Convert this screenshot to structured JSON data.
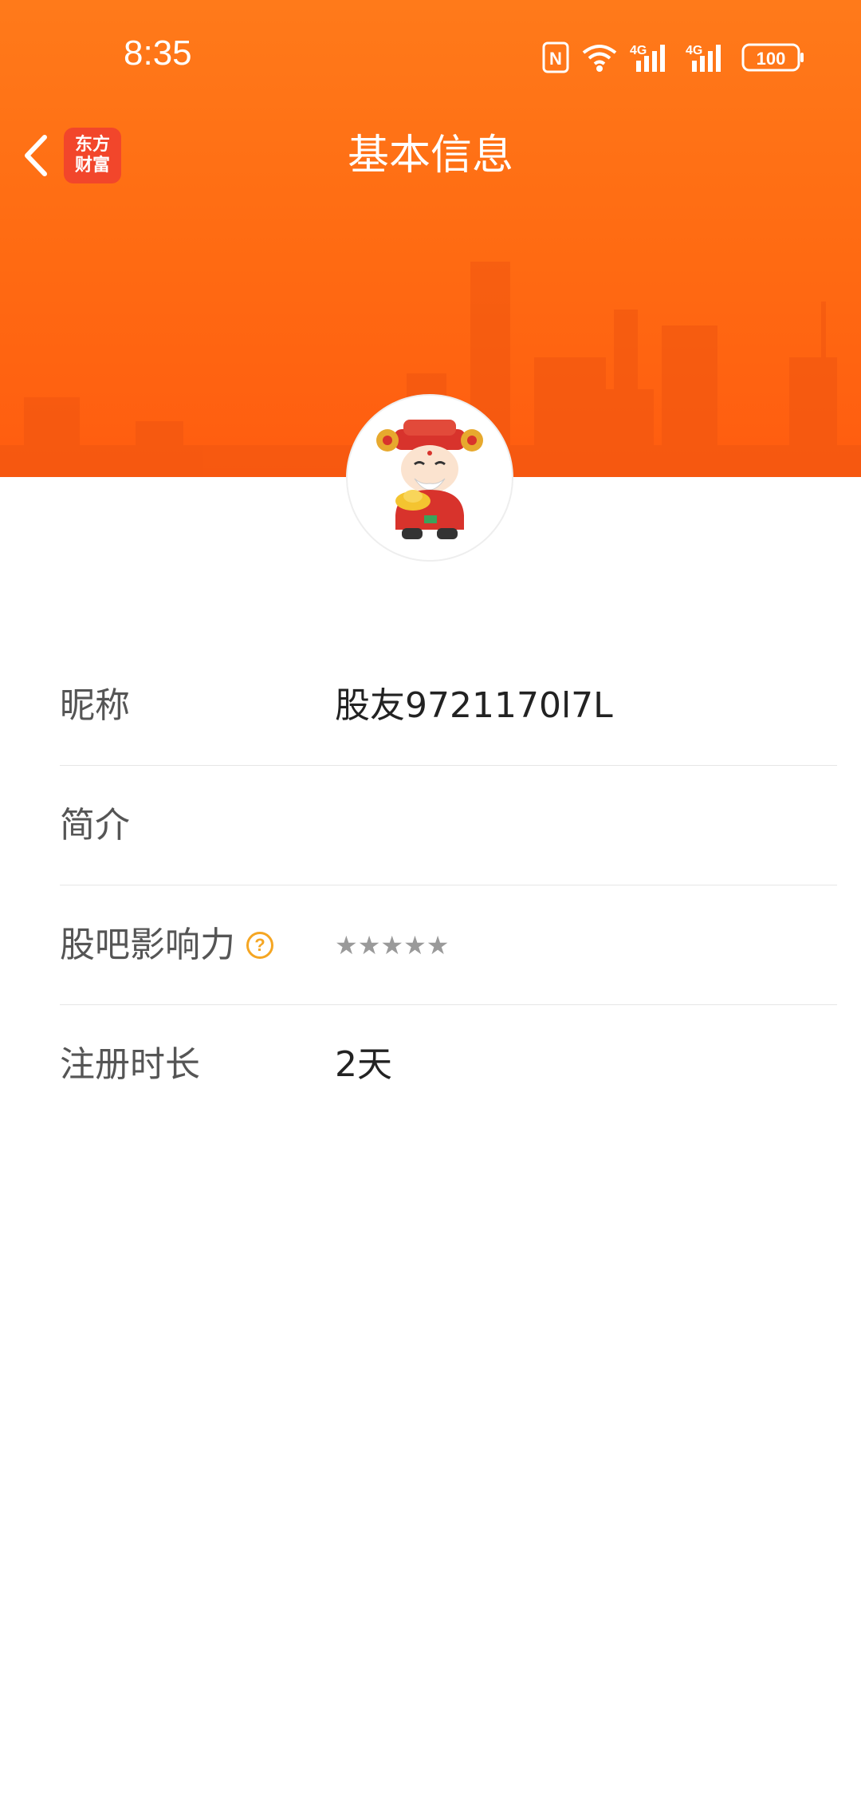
{
  "status_bar": {
    "time": "8:35",
    "nfc_label": "N",
    "signal1_label": "4G",
    "signal2_label": "4G",
    "battery": "100"
  },
  "nav": {
    "title": "基本信息",
    "logo_line1": "东方",
    "logo_line2": "财富"
  },
  "profile": {
    "rows": [
      {
        "label": "昵称",
        "value": "股友9721170l7L"
      },
      {
        "label": "简介",
        "value": ""
      },
      {
        "label": "股吧影响力",
        "help": "?",
        "rating": "★★★★★"
      },
      {
        "label": "注册时长",
        "value": "2天"
      }
    ]
  },
  "colors": {
    "header_orange": "#ff6a12",
    "logo_red": "#f2462b",
    "help_orange": "#f5a623",
    "star_gray": "#9a9a9a"
  }
}
